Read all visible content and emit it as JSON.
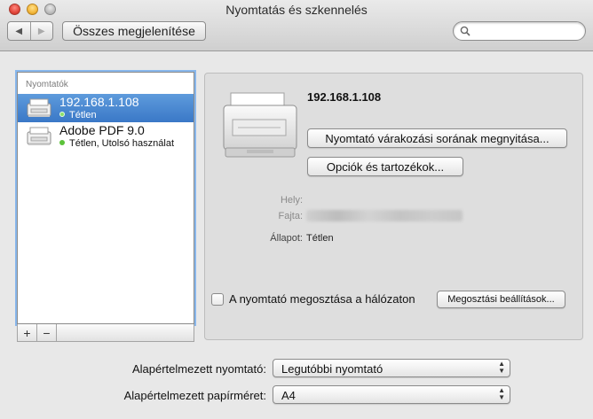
{
  "window": {
    "title": "Nyomtatás és szkennelés"
  },
  "toolbar": {
    "back_glyph": "◀",
    "forward_glyph": "▶",
    "show_all_label": "Összes megjelenítése",
    "search_placeholder": "",
    "search_icon": "magnifier-icon"
  },
  "printers": {
    "header": "Nyomtatók",
    "items": [
      {
        "name": "192.168.1.108",
        "status": "Tétlen",
        "selected": true
      },
      {
        "name": "Adobe PDF 9.0",
        "status": "Tétlen, Utolsó használat",
        "selected": false
      }
    ],
    "add_glyph": "+",
    "remove_glyph": "−"
  },
  "detail": {
    "name": "192.168.1.108",
    "queue_button": "Nyomtató várakozási sorának megnyitása...",
    "options_button": "Opciók és tartozékok...",
    "location_label": "Hely:",
    "location_value": "",
    "kind_label": "Fajta:",
    "status_label": "Állapot:",
    "status_value": "Tétlen",
    "share_label": "A nyomtató megosztása a hálózaton",
    "share_checked": false,
    "sharing_button": "Megosztási beállítások..."
  },
  "defaults": {
    "printer_label": "Alapértelmezett nyomtató:",
    "printer_value": "Legutóbbi nyomtató",
    "paper_label": "Alapértelmezett papírméret:",
    "paper_value": "A4"
  },
  "colors": {
    "selection": "#3a78c7",
    "status_dot": "#5cc23a",
    "focus_ring": "#88b7ec"
  }
}
